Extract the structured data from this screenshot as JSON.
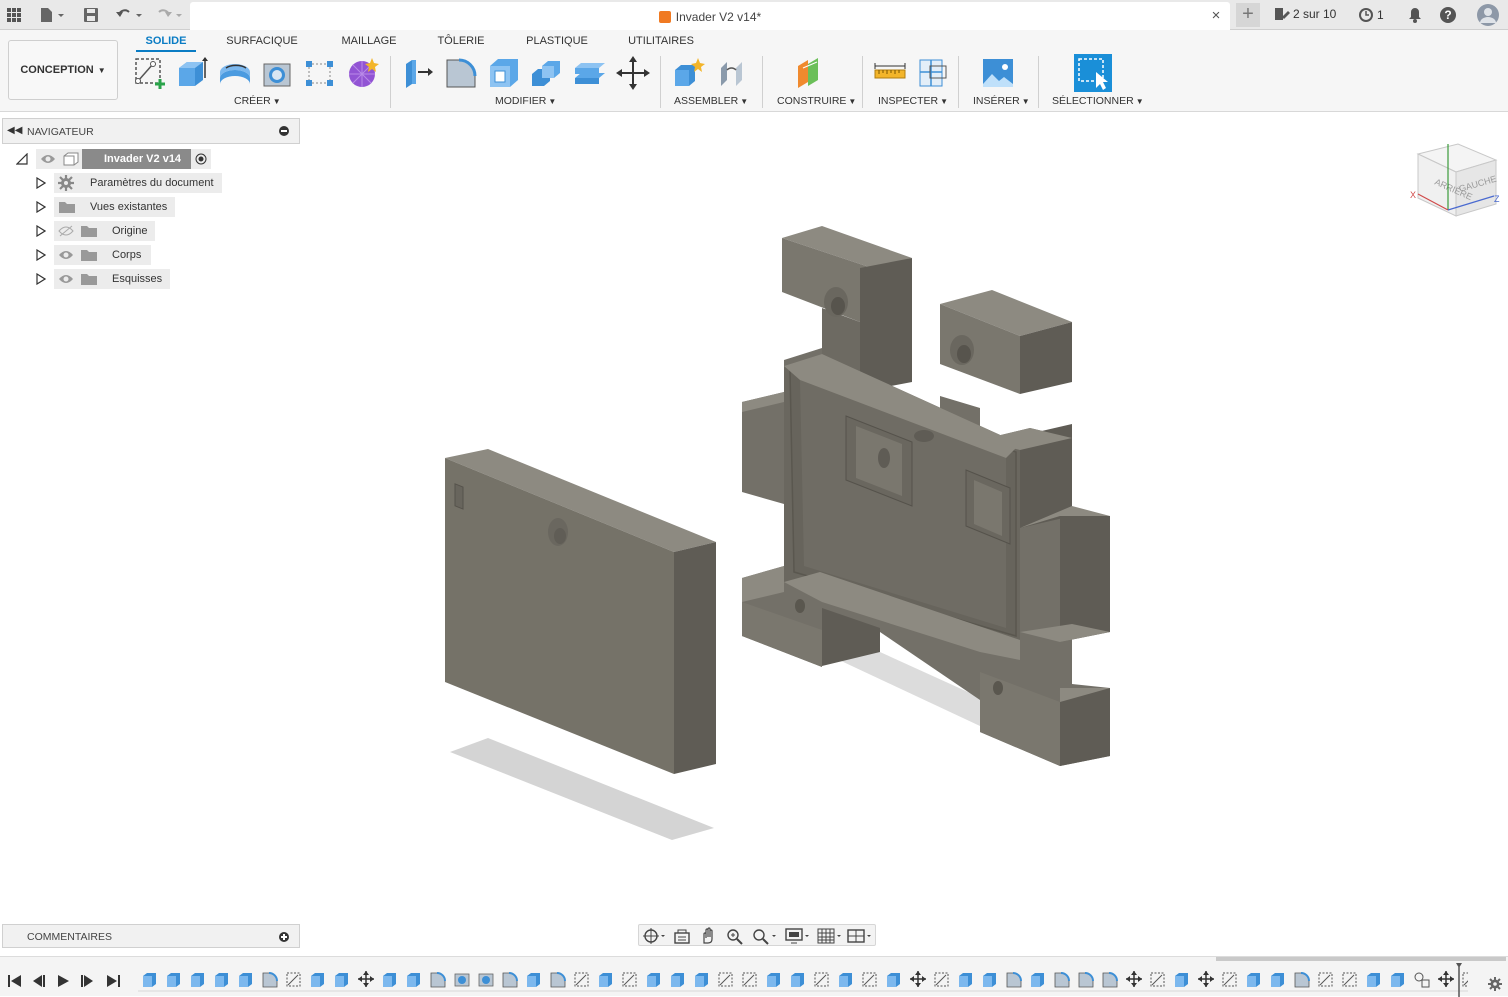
{
  "titlebar": {
    "doc_title": "Invader V2 v14*",
    "close_glyph": "×",
    "new_tab_glyph": "+",
    "jobs_label": "2 sur 10",
    "history_count": "1"
  },
  "ribbon": {
    "workspace_label": "CONCEPTION",
    "tabs": [
      "SOLIDE",
      "SURFACIQUE",
      "MAILLAGE",
      "TÔLERIE",
      "PLASTIQUE",
      "UTILITAIRES"
    ],
    "active_tab": "SOLIDE",
    "groups": [
      "CRÉER",
      "MODIFIER",
      "ASSEMBLER",
      "CONSTRUIRE",
      "INSPECTER",
      "INSÉRER",
      "SÉLECTIONNER"
    ]
  },
  "navigator": {
    "title": "NAVIGATEUR",
    "root": "Invader V2 v14",
    "items": [
      "Paramètres du document",
      "Vues existantes",
      "Origine",
      "Corps",
      "Esquisses"
    ]
  },
  "viewcube": {
    "face_back": "ARRIÈRE",
    "face_left": "GAUCHE",
    "axis_x": "X",
    "axis_z": "Z"
  },
  "comments": {
    "title": "COMMENTAIRES"
  },
  "colors": {
    "accent": "#0a7cc4",
    "model_front": "#737068",
    "model_top": "#8d8a81",
    "model_side": "#5f5c55"
  }
}
